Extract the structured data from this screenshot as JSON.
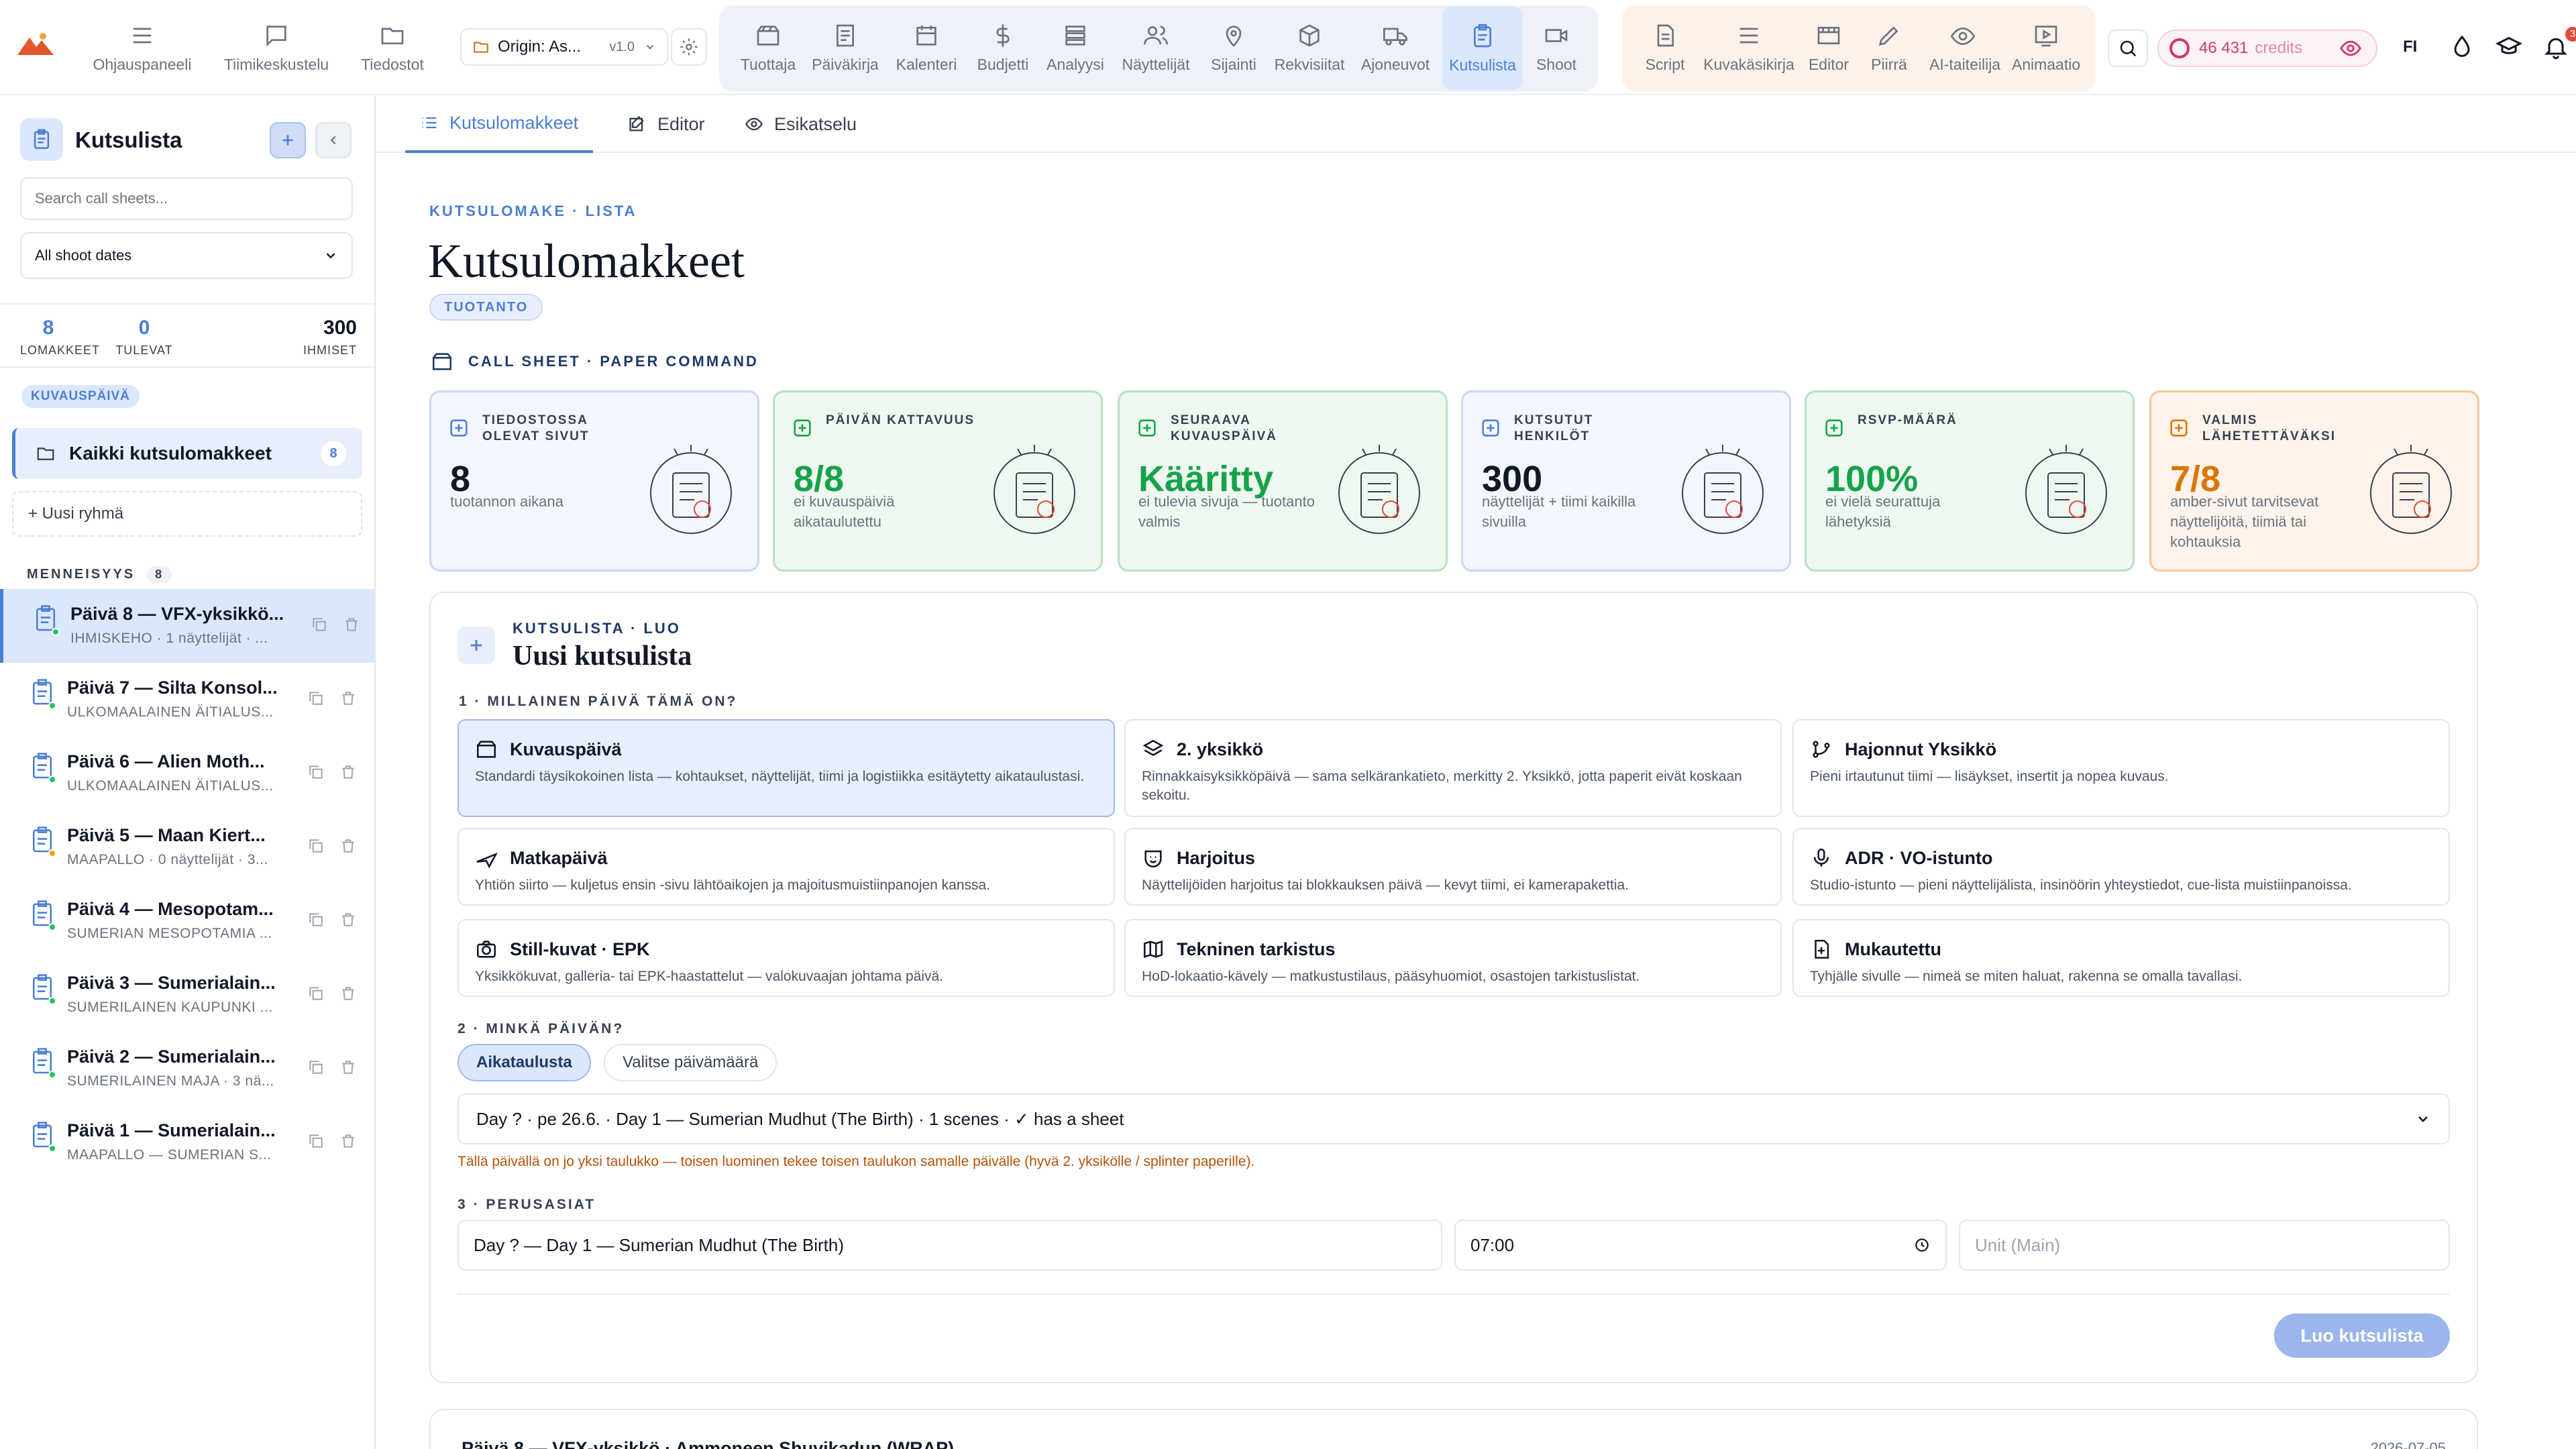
{
  "topnav": {
    "items": [
      {
        "label": "Ohjauspaneeli",
        "icon": "dashboard-icon"
      },
      {
        "label": "Tiimikeskustelu",
        "icon": "chat-icon"
      },
      {
        "label": "Tiedostot",
        "icon": "folder-icon"
      }
    ],
    "project": {
      "name": "Origin: As...",
      "version": "v1.0"
    },
    "production_items": [
      {
        "label": "Tuottaja",
        "icon": "clapper-icon"
      },
      {
        "label": "Päiväkirja",
        "icon": "journal-icon"
      },
      {
        "label": "Kalenteri",
        "icon": "calendar-icon"
      },
      {
        "label": "Budjetti",
        "icon": "dollar-icon"
      },
      {
        "label": "Analyysi",
        "icon": "layers-icon"
      },
      {
        "label": "Näyttelijät",
        "icon": "people-icon"
      },
      {
        "label": "Sijainti",
        "icon": "location-pin-icon"
      },
      {
        "label": "Rekvisiitat",
        "icon": "box-icon"
      },
      {
        "label": "Ajoneuvot",
        "icon": "truck-icon"
      },
      {
        "label": "Kutsulista",
        "icon": "clipboard-icon"
      },
      {
        "label": "Shoot",
        "icon": "video-camera-icon"
      }
    ],
    "creative_items": [
      {
        "label": "Script",
        "icon": "script-icon"
      },
      {
        "label": "Kuvakäsikirja",
        "icon": "storyboard-icon"
      },
      {
        "label": "Editor",
        "icon": "film-icon"
      },
      {
        "label": "Piirrä",
        "icon": "pencil-icon"
      },
      {
        "label": "AI-taiteilija",
        "icon": "eye-icon"
      },
      {
        "label": "Animaatio",
        "icon": "play-screen-icon"
      }
    ],
    "credits": {
      "amount": "46 431",
      "unit": "credits"
    },
    "language": "FI",
    "notifications": "3"
  },
  "sidebar": {
    "title": "Kutsulista",
    "search_placeholder": "Search call sheets...",
    "date_filter": "All shoot dates",
    "stats": [
      {
        "value": "8",
        "label": "LOMAKKEET"
      },
      {
        "value": "0",
        "label": "TULEVAT"
      },
      {
        "value": "300",
        "label": "IHMISET"
      }
    ],
    "pill": "KUVAUSPÄIVÄ",
    "all_sheets": {
      "label": "Kaikki kutsulomakkeet",
      "count": "8"
    },
    "new_group": "+  Uusi ryhmä",
    "past_label": "MENNEISYYS",
    "past_count": "8",
    "sheets": [
      {
        "title": "Päivä 8 — VFX-yksikkö...",
        "sub": "IHMISKEHO · 1 näyttelijät · ...",
        "dot": "#22c55e"
      },
      {
        "title": "Päivä 7 — Silta Konsol...",
        "sub": "ULKOMAALAINEN ÄITIALUS...",
        "dot": "#22c55e"
      },
      {
        "title": "Päivä 6 — Alien Moth...",
        "sub": "ULKOMAALAINEN ÄITIALUS...",
        "dot": "#22c55e"
      },
      {
        "title": "Päivä 5 — Maan Kiert...",
        "sub": "MAAPALLO · 0 näyttelijät · 3...",
        "dot": "#f59e0b"
      },
      {
        "title": "Päivä 4 — Mesopotam...",
        "sub": "SUMERIAN MESOPOTAMIA ...",
        "dot": "#22c55e"
      },
      {
        "title": "Päivä 3 — Sumerialain...",
        "sub": "SUMERILAINEN KAUPUNKI ...",
        "dot": "#22c55e"
      },
      {
        "title": "Päivä 2 — Sumerialain...",
        "sub": "SUMERILAINEN MAJA · 3 nä...",
        "dot": "#22c55e"
      },
      {
        "title": "Päivä 1 — Sumerialain...",
        "sub": "MAAPALLO — SUMERIAN S...",
        "dot": "#22c55e"
      }
    ]
  },
  "tabs": [
    {
      "label": "Kutsulomakkeet",
      "icon": "list-icon"
    },
    {
      "label": "Editor",
      "icon": "edit-icon"
    },
    {
      "label": "Esikatselu",
      "icon": "eye-icon"
    }
  ],
  "header": {
    "kicker": "KUTSULOMAKE · LISTA",
    "title": "Kutsulomakkeet",
    "badge": "TUOTANTO",
    "section": "CALL SHEET · PAPER COMMAND"
  },
  "cards": [
    {
      "label": "TIEDOSTOSSA OLEVAT SIVUT",
      "value": "8",
      "sub": "tuotannon aikana",
      "tone": "blue"
    },
    {
      "label": "PÄIVÄN KATTAVUUS",
      "value": "8/8",
      "sub": "ei kuvauspäiviä aikataulutettu",
      "tone": "green"
    },
    {
      "label": "SEURAAVA KUVAUSPÄIVÄ",
      "value": "Kääritty",
      "sub": "ei tulevia sivuja — tuotanto valmis",
      "tone": "green"
    },
    {
      "label": "KUTSUTUT HENKILÖT",
      "value": "300",
      "sub": "näyttelijät + tiimi kaikilla sivuilla",
      "tone": "blue"
    },
    {
      "label": "RSVP-MÄÄRÄ",
      "value": "100%",
      "sub": "ei vielä seurattuja lähetyksiä",
      "tone": "green"
    },
    {
      "label": "VALMIS LÄHETETTÄVÄKSI",
      "value": "7/8",
      "sub": "amber-sivut tarvitsevat näyttelijöitä, tiimiä tai kohtauksia",
      "tone": "amber"
    }
  ],
  "new_sheet": {
    "kicker": "KUTSULISTA · LUO",
    "title": "Uusi kutsulista",
    "q1": "1 · MILLAINEN PÄIVÄ TÄMÄ ON?",
    "types": [
      {
        "name": "Kuvauspäivä",
        "desc": "Standardi täysikokoinen lista — kohtaukset, näyttelijät, tiimi ja logistiikka esitäytetty aikataulustasi.",
        "icon": "clapper-icon"
      },
      {
        "name": "2. yksikkö",
        "desc": "Rinnakkaisyksikköpäivä — sama selkärankatieto, merkitty 2. Yksikkö, jotta paperit eivät koskaan sekoitu.",
        "icon": "stack-icon"
      },
      {
        "name": "Hajonnut Yksikkö",
        "desc": "Pieni irtautunut tiimi — lisäykset, insertit ja nopea kuvaus.",
        "icon": "branch-icon"
      },
      {
        "name": "Matkapäivä",
        "desc": "Yhtiön siirto — kuljetus ensin -sivu lähtöaikojen ja majoitusmuistiinpanojen kanssa.",
        "icon": "plane-icon"
      },
      {
        "name": "Harjoitus",
        "desc": "Näyttelijöiden harjoitus tai blokkauksen päivä — kevyt tiimi, ei kamerapakettia.",
        "icon": "theater-icon"
      },
      {
        "name": "ADR · VO-istunto",
        "desc": "Studio-istunto — pieni näyttelijälista, insinöörin yhteystiedot, cue-lista muistiinpanoissa.",
        "icon": "microphone-icon"
      },
      {
        "name": "Still-kuvat · EPK",
        "desc": "Yksikkökuvat, galleria- tai EPK-haastattelut — valokuvaajan johtama päivä.",
        "icon": "camera-icon"
      },
      {
        "name": "Tekninen tarkistus",
        "desc": "HoD-lokaatio-kävely — matkustustilaus, pääsyhuomiot, osastojen tarkistuslistat.",
        "icon": "map-icon"
      },
      {
        "name": "Mukautettu",
        "desc": "Tyhjälle sivulle — nimeä se miten haluat, rakenna se omalla tavallasi.",
        "icon": "file-plus-icon"
      }
    ],
    "q2": "2 · MINKÄ PÄIVÄN?",
    "seg_schedule": "Aikataulusta",
    "seg_date": "Valitse päivämäärä",
    "day_value": "Day ? · pe 26.6. · Day 1 — Sumerian Mudhut (The Birth) · 1 scenes · ✓ has a sheet",
    "warning": "Tällä päivällä on jo yksi taulukko — toisen luominen tekee toisen taulukon samalle päivälle (hyvä 2. yksikölle / splinter paperille).",
    "q3": "3 · PERUSASIAT",
    "title_value": "Day ? — Day 1 — Sumerian Mudhut (The Birth)",
    "time_value": "07:00",
    "unit_placeholder": "Unit (Main)",
    "create_label": "Luo kutsulista"
  },
  "next_sheet": {
    "title": "Päivä 8 — VFX-yksikkö · Ammoneen Shuvikadun (WRAP)",
    "date": "2026-07-05"
  },
  "colors": {
    "accent": "#4a7fd4",
    "green": "#16a34a",
    "amber": "#d97706",
    "card_blue_bg": "#f3f6fd",
    "card_green_bg": "#eef8f0",
    "card_amber_bg": "#fdf3ea"
  }
}
